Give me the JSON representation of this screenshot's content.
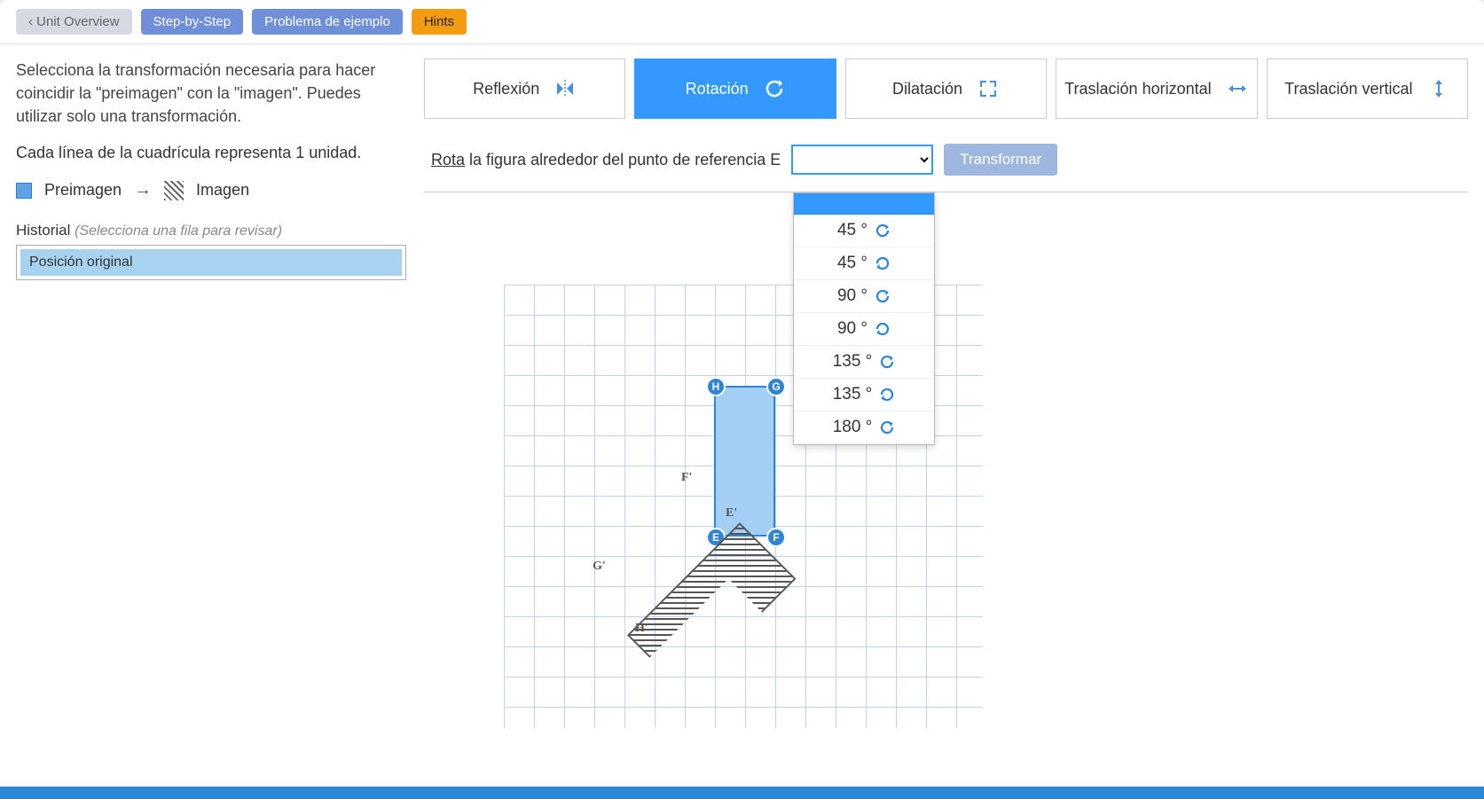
{
  "nav": {
    "overview": "‹ Unit Overview",
    "step": "Step-by-Step",
    "example": "Problema de ejemplo",
    "hints": "Hints"
  },
  "instructions": {
    "line1": "Selecciona la transformación necesaria para hacer coincidir la \"preimagen\" con la \"imagen\". Puedes utilizar solo una transformación.",
    "line2": "Cada línea de la cuadrícula representa 1 unidad."
  },
  "legend": {
    "preimage": "Preimagen",
    "image": "Imagen"
  },
  "history": {
    "label": "Historial",
    "hint": "(Selecciona una fila para revisar)",
    "items": [
      "Posición original"
    ]
  },
  "transforms": {
    "reflexion": "Reflexión",
    "rotacion": "Rotación",
    "dilatacion": "Dilatación",
    "tras_h": "Traslación horizontal",
    "tras_v": "Traslación vertical"
  },
  "action": {
    "verb": "Rota",
    "rest": " la figura alrededor del punto de referencia E",
    "button": "Transformar"
  },
  "dropdown": {
    "options": [
      "45 °",
      "45 °",
      "90 °",
      "90 °",
      "135 °",
      "135 °",
      "180 °"
    ]
  },
  "vertices": {
    "H": "H",
    "G": "G",
    "E": "E",
    "F": "F",
    "Fp": "F'",
    "Ep": "E'",
    "Gp": "G'",
    "Hp": "H'"
  }
}
